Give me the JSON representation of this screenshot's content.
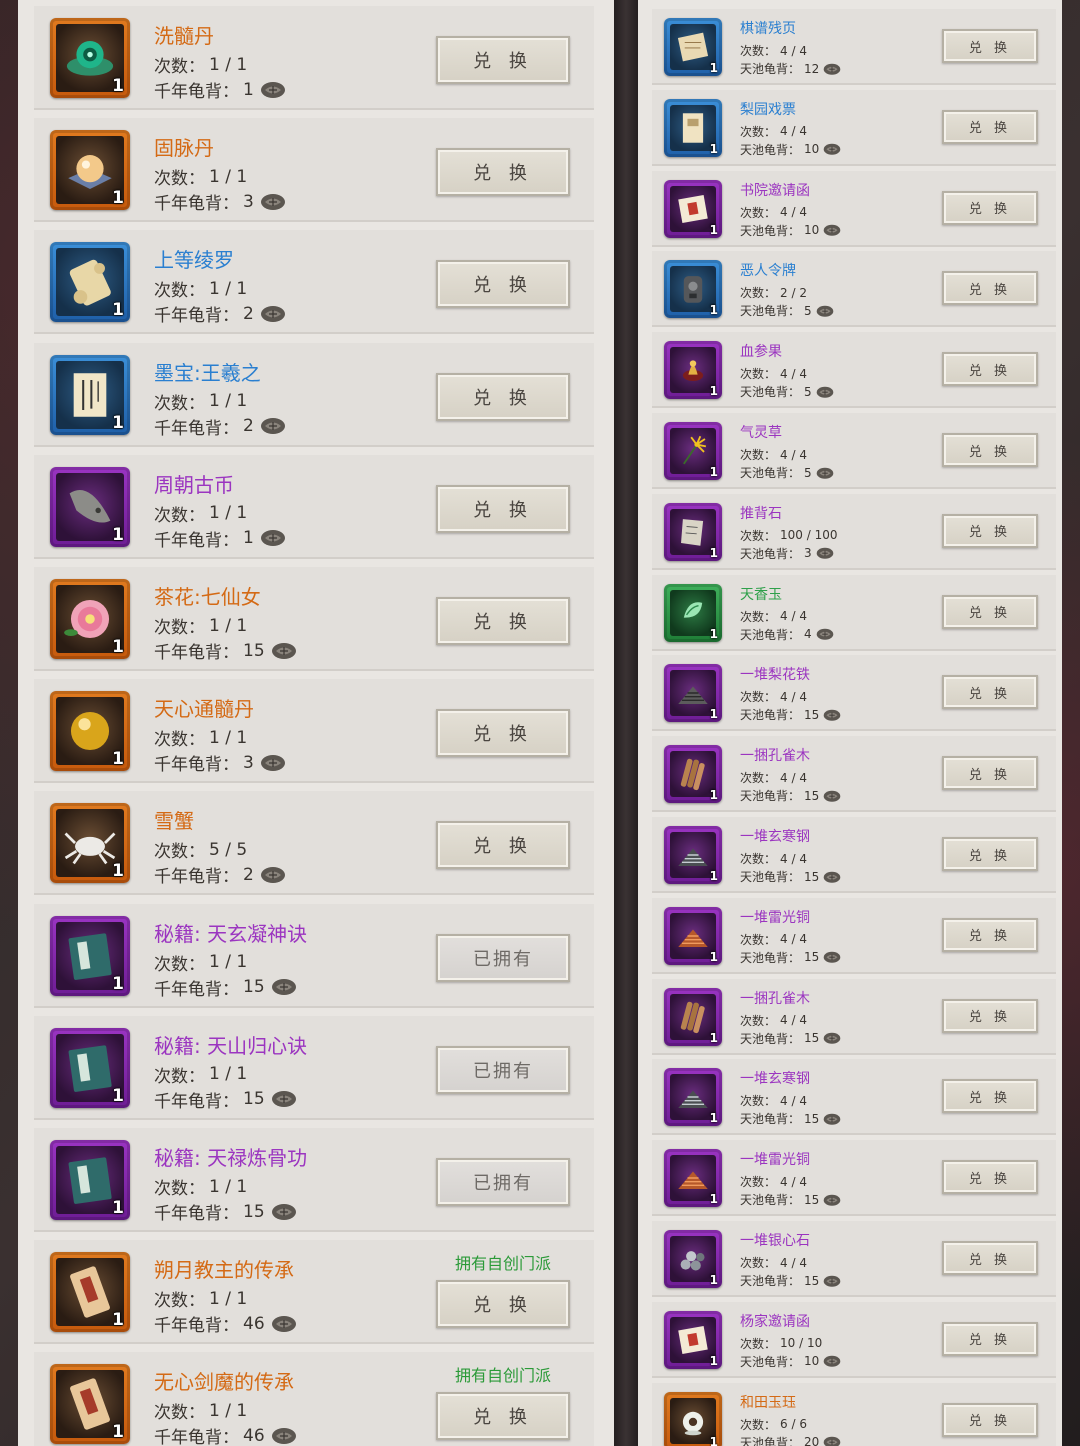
{
  "labels": {
    "count_label": "次数：",
    "count_label_compact": "次数：",
    "cost_left": "千年龟背：",
    "cost_right": "天池龟背："
  },
  "left_items": [
    {
      "name": "洗髓丹",
      "color": "orange",
      "frame": "orange",
      "icon": "pill-icon",
      "qty": "1",
      "count": "1 / 1",
      "cost": "1",
      "button": "兑 换"
    },
    {
      "name": "固脉丹",
      "color": "orange",
      "frame": "orange",
      "icon": "orb-pill-icon",
      "qty": "1",
      "count": "1 / 1",
      "cost": "3",
      "button": "兑 换"
    },
    {
      "name": "上等绫罗",
      "color": "blue",
      "frame": "blue",
      "icon": "silk-scroll-icon",
      "qty": "1",
      "count": "1 / 1",
      "cost": "2",
      "button": "兑 换"
    },
    {
      "name": "墨宝:王羲之",
      "color": "blue",
      "frame": "blue",
      "icon": "calligraphy-scroll-icon",
      "qty": "1",
      "count": "1 / 1",
      "cost": "2",
      "button": "兑 换"
    },
    {
      "name": "周朝古币",
      "color": "purple",
      "frame": "purple",
      "icon": "ancient-coin-icon",
      "qty": "1",
      "count": "1 / 1",
      "cost": "1",
      "button": "兑 换"
    },
    {
      "name": "茶花:七仙女",
      "color": "orange",
      "frame": "orange",
      "icon": "camellia-flower-icon",
      "qty": "1",
      "count": "1 / 1",
      "cost": "15",
      "button": "兑 换"
    },
    {
      "name": "天心通髓丹",
      "color": "orange",
      "frame": "orange",
      "icon": "golden-pill-icon",
      "qty": "1",
      "count": "1 / 1",
      "cost": "3",
      "button": "兑 换"
    },
    {
      "name": "雪蟹",
      "color": "orange",
      "frame": "orange",
      "icon": "snow-crab-icon",
      "qty": "1",
      "count": "5 / 5",
      "cost": "2",
      "button": "兑 换"
    },
    {
      "name": "秘籍: 天玄凝神诀",
      "color": "purple",
      "frame": "purple",
      "icon": "manual-book-icon",
      "qty": "1",
      "count": "1 / 1",
      "cost": "15",
      "button": "已拥有",
      "owned": true
    },
    {
      "name": "秘籍: 天山归心诀",
      "color": "purple",
      "frame": "purple",
      "icon": "manual-book-icon",
      "qty": "1",
      "count": "1 / 1",
      "cost": "15",
      "button": "已拥有",
      "owned": true
    },
    {
      "name": "秘籍: 天禄炼骨功",
      "color": "purple",
      "frame": "purple",
      "icon": "manual-book-icon",
      "qty": "1",
      "count": "1 / 1",
      "cost": "15",
      "button": "已拥有",
      "owned": true
    },
    {
      "name": "朔月教主的传承",
      "color": "orange",
      "frame": "orange",
      "icon": "inheritance-scroll-icon",
      "qty": "1",
      "count": "1 / 1",
      "cost": "46",
      "button": "兑 换",
      "requirement": "拥有自创门派"
    },
    {
      "name": "无心剑魔的传承",
      "color": "orange",
      "frame": "orange",
      "icon": "inheritance-scroll-icon",
      "qty": "1",
      "count": "1 / 1",
      "cost": "46",
      "button": "兑 换",
      "requirement": "拥有自创门派"
    }
  ],
  "right_items": [
    {
      "name": "棋谱残页",
      "color": "blue",
      "frame": "blue",
      "icon": "chess-manual-icon",
      "qty": "1",
      "count": "4 / 4",
      "cost": "12",
      "button": "兑 换"
    },
    {
      "name": "梨园戏票",
      "color": "blue",
      "frame": "blue",
      "icon": "theater-ticket-icon",
      "qty": "1",
      "count": "4 / 4",
      "cost": "10",
      "button": "兑 换"
    },
    {
      "name": "书院邀请函",
      "color": "purple",
      "frame": "purple",
      "icon": "invitation-letter-icon",
      "qty": "1",
      "count": "4 / 4",
      "cost": "10",
      "button": "兑 换"
    },
    {
      "name": "恶人令牌",
      "color": "blue",
      "frame": "blue",
      "icon": "token-icon",
      "qty": "1",
      "count": "2 / 2",
      "cost": "5",
      "button": "兑 换"
    },
    {
      "name": "血参果",
      "color": "purple",
      "frame": "purple",
      "icon": "ginseng-fruit-icon",
      "qty": "1",
      "count": "4 / 4",
      "cost": "5",
      "button": "兑 换"
    },
    {
      "name": "气灵草",
      "color": "purple",
      "frame": "purple",
      "icon": "herb-icon",
      "qty": "1",
      "count": "4 / 4",
      "cost": "5",
      "button": "兑 换"
    },
    {
      "name": "推背石",
      "color": "purple",
      "frame": "purple",
      "icon": "stone-tablet-icon",
      "qty": "1",
      "count": "100 / 100",
      "cost": "3",
      "button": "兑 换"
    },
    {
      "name": "天香玉",
      "color": "green",
      "frame": "green",
      "icon": "jade-icon",
      "qty": "1",
      "count": "4 / 4",
      "cost": "4",
      "button": "兑 换"
    },
    {
      "name": "一堆梨花铁",
      "color": "purple",
      "frame": "purple",
      "icon": "iron-pile-icon",
      "qty": "1",
      "count": "4 / 4",
      "cost": "15",
      "button": "兑 换"
    },
    {
      "name": "一捆孔雀木",
      "color": "purple",
      "frame": "purple",
      "icon": "wood-bundle-icon",
      "qty": "1",
      "count": "4 / 4",
      "cost": "15",
      "button": "兑 换"
    },
    {
      "name": "一堆玄寒钢",
      "color": "purple",
      "frame": "purple",
      "icon": "steel-pile-icon",
      "qty": "1",
      "count": "4 / 4",
      "cost": "15",
      "button": "兑 换"
    },
    {
      "name": "一堆雷光铜",
      "color": "purple",
      "frame": "purple",
      "icon": "copper-pile-icon",
      "qty": "1",
      "count": "4 / 4",
      "cost": "15",
      "button": "兑 换"
    },
    {
      "name": "一捆孔雀木",
      "color": "purple",
      "frame": "purple",
      "icon": "wood-bundle-icon",
      "qty": "1",
      "count": "4 / 4",
      "cost": "15",
      "button": "兑 换"
    },
    {
      "name": "一堆玄寒钢",
      "color": "purple",
      "frame": "purple",
      "icon": "steel-pile-icon",
      "qty": "1",
      "count": "4 / 4",
      "cost": "15",
      "button": "兑 换"
    },
    {
      "name": "一堆雷光铜",
      "color": "purple",
      "frame": "purple",
      "icon": "copper-pile-icon",
      "qty": "1",
      "count": "4 / 4",
      "cost": "15",
      "button": "兑 换"
    },
    {
      "name": "一堆银心石",
      "color": "purple",
      "frame": "purple",
      "icon": "silver-stone-pile-icon",
      "qty": "1",
      "count": "4 / 4",
      "cost": "15",
      "button": "兑 换"
    },
    {
      "name": "杨家邀请函",
      "color": "purple",
      "frame": "purple",
      "icon": "invitation-letter-icon",
      "qty": "1",
      "count": "10 / 10",
      "cost": "10",
      "button": "兑 换"
    },
    {
      "name": "和田玉珏",
      "color": "orange",
      "frame": "orange",
      "icon": "jade-ring-icon",
      "qty": "1",
      "count": "6 / 6",
      "cost": "20",
      "button": "兑 换"
    }
  ],
  "colors": {
    "orange": "#d46a15",
    "blue": "#2a7fd0",
    "purple": "#9b35c0",
    "green": "#2ea04a"
  }
}
